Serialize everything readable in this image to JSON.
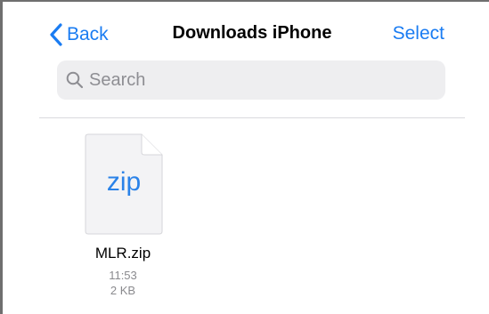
{
  "nav": {
    "back_label": "Back",
    "title": "Downloads iPhone",
    "select_label": "Select"
  },
  "search": {
    "placeholder": "Search",
    "value": ""
  },
  "files": [
    {
      "icon_text": "zip",
      "name": "MLR.zip",
      "time": "11:53",
      "size": "2 KB"
    }
  ],
  "colors": {
    "accent": "#1a7cf2",
    "search_bg": "#eeeef0",
    "secondary_text": "#8a8a8e",
    "file_icon_text": "#2a82e8"
  }
}
